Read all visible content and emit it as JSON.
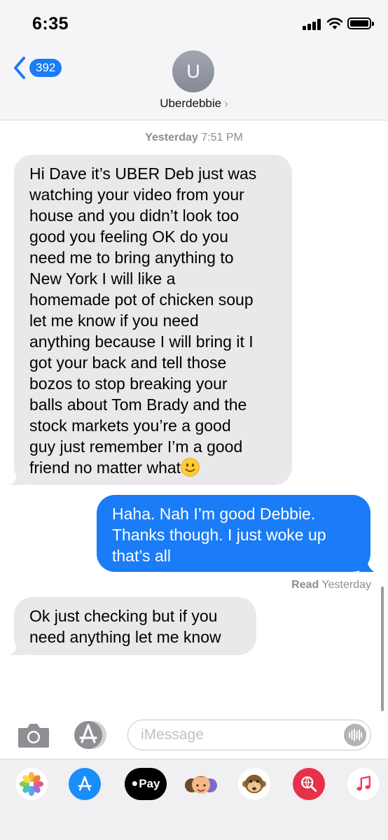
{
  "status_bar": {
    "time": "6:35"
  },
  "header": {
    "back_count": "392",
    "avatar_initial": "U",
    "contact_name": "Uberdebbie",
    "chevron": "›"
  },
  "conversation": {
    "timestamp_day": "Yesterday",
    "timestamp_time": "7:51 PM",
    "messages": [
      {
        "direction": "incoming",
        "lines": [
          "Hi Dave it’s UBER Deb just was",
          "watching your video from your",
          "house and you didn’t look too",
          "good you feeling OK do you",
          "need me to bring anything to",
          "New York I will like a",
          "homemade pot of chicken soup",
          "let me know if you need",
          "anything because I will bring it I",
          "got your back and tell those",
          "bozos to stop breaking your",
          "balls about Tom Brady and the",
          "stock markets you’re a good",
          "guy just remember I’m a good",
          "friend no matter what"
        ],
        "emoji": "slightly-smiling-face"
      },
      {
        "direction": "outgoing",
        "lines": [
          "Haha.  Nah I’m good Debbie.",
          "Thanks though.   I just woke up",
          "that’s all"
        ]
      },
      {
        "direction": "incoming",
        "lines": [
          "Ok just checking but if you",
          "need anything let me know"
        ]
      }
    ],
    "read_receipt_label": "Read",
    "read_receipt_time": "Yesterday"
  },
  "input_bar": {
    "placeholder": "iMessage"
  },
  "app_drawer": {
    "apps": [
      "photos-icon",
      "app-store-icon",
      "apple-pay-icon",
      "memoji-icon",
      "animoji-icon",
      "web-search-icon",
      "music-icon"
    ],
    "apple_pay_label": "Pay"
  },
  "colors": {
    "accent_blue": "#1a7cf6",
    "incoming_bubble": "#e9e9eb",
    "meta_gray": "#8e8e93",
    "header_bg": "#f5f5f7"
  }
}
